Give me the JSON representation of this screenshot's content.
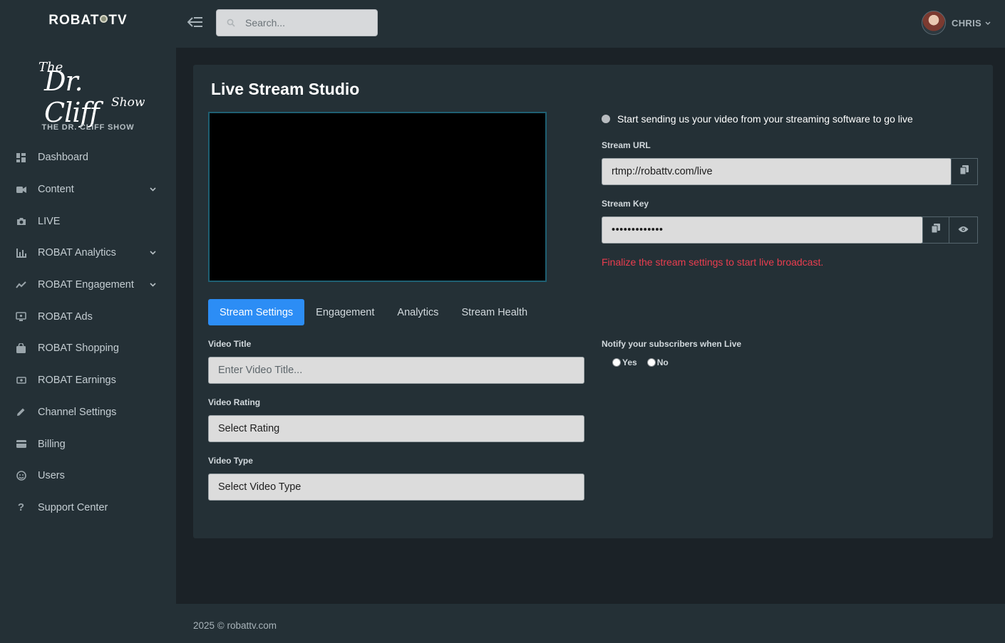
{
  "brand": {
    "name_left": "ROBAT",
    "name_right": "TV"
  },
  "logo": {
    "the": "The",
    "title": "Dr. Cliff",
    "show": "Show"
  },
  "channel_name": "THE DR. CLIFF SHOW",
  "sidebar": {
    "items": [
      {
        "label": "Dashboard",
        "icon": "dashboard-icon",
        "chevron": false
      },
      {
        "label": "Content",
        "icon": "video-camera-icon",
        "chevron": true
      },
      {
        "label": "LIVE",
        "icon": "camera-icon",
        "chevron": false
      },
      {
        "label": "ROBAT Analytics",
        "icon": "bar-chart-icon",
        "chevron": true
      },
      {
        "label": "ROBAT Engagement",
        "icon": "trend-line-icon",
        "chevron": true
      },
      {
        "label": "ROBAT Ads",
        "icon": "ad-screen-icon",
        "chevron": false
      },
      {
        "label": "ROBAT Shopping",
        "icon": "shopping-bag-icon",
        "chevron": false
      },
      {
        "label": "ROBAT Earnings",
        "icon": "money-icon",
        "chevron": false
      },
      {
        "label": "Channel Settings",
        "icon": "pencil-icon",
        "chevron": false
      },
      {
        "label": "Billing",
        "icon": "credit-card-icon",
        "chevron": false
      },
      {
        "label": "Users",
        "icon": "users-icon",
        "chevron": false
      },
      {
        "label": "Support Center",
        "icon": "question-icon",
        "chevron": false
      }
    ]
  },
  "topbar": {
    "search_placeholder": "Search...",
    "user_name": "CHRIS"
  },
  "main": {
    "title": "Live Stream Studio",
    "status_text": "Start sending us your video from your streaming software to go live",
    "stream_url_label": "Stream URL",
    "stream_url_value": "rtmp://robattv.com/live",
    "stream_key_label": "Stream Key",
    "stream_key_value": "•••••••••••••",
    "error_text": "Finalize the stream settings to start live broadcast.",
    "tabs": [
      {
        "label": "Stream Settings",
        "active": true
      },
      {
        "label": "Engagement",
        "active": false
      },
      {
        "label": "Analytics",
        "active": false
      },
      {
        "label": "Stream Health",
        "active": false
      }
    ],
    "video_title_label": "Video Title",
    "video_title_placeholder": "Enter Video Title...",
    "video_rating_label": "Video Rating",
    "video_rating_value": "Select Rating",
    "video_type_label": "Video Type",
    "video_type_value": "Select Video Type",
    "notify_label": "Notify your subscribers when Live",
    "notify_yes": "Yes",
    "notify_no": "No"
  },
  "footer": {
    "text": "2025 © robattv.com"
  },
  "colors": {
    "accent": "#2c8df5",
    "error": "#ea3d4f",
    "sidebar_bg": "#243036",
    "page_bg": "#1b2227"
  }
}
